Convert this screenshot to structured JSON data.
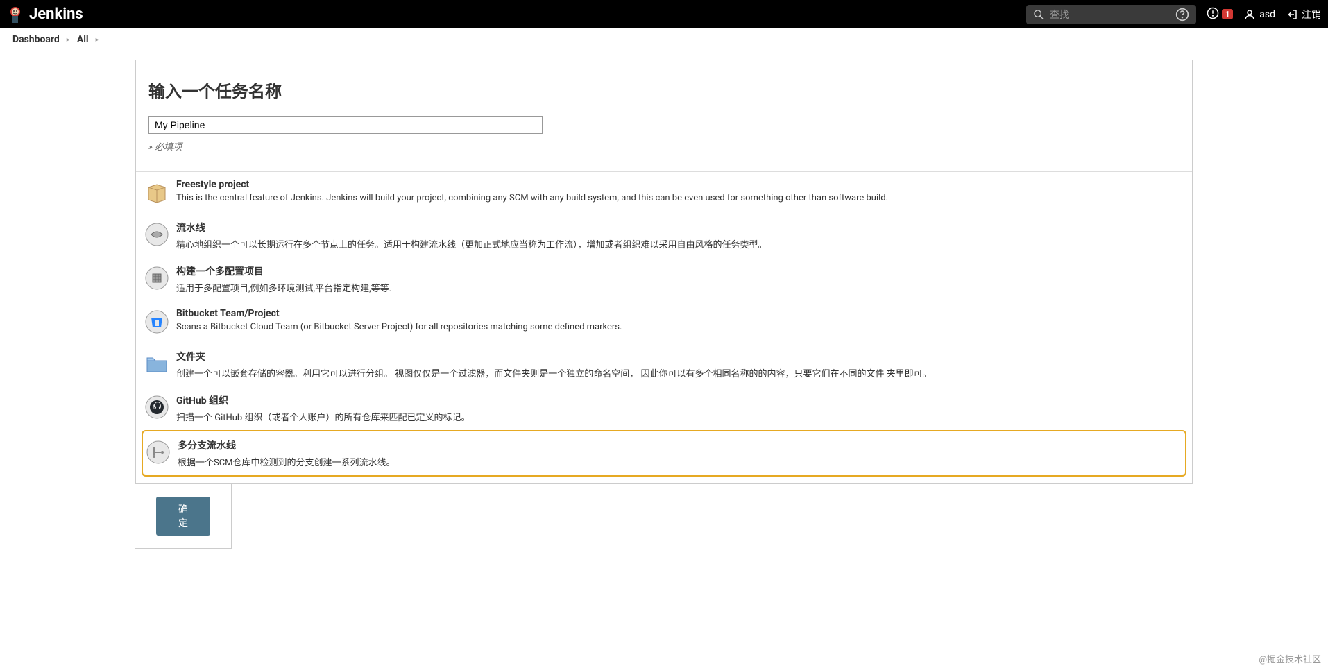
{
  "header": {
    "brand": "Jenkins",
    "search_placeholder": "查找",
    "alert_count": "1",
    "user": "asd",
    "logout": "注销"
  },
  "breadcrumbs": [
    {
      "label": "Dashboard"
    },
    {
      "label": "All"
    }
  ],
  "form": {
    "title": "输入一个任务名称",
    "name_value": "My Pipeline",
    "required_note": "» 必填项",
    "submit": "确定"
  },
  "items": [
    {
      "title": "Freestyle project",
      "desc": "This is the central feature of Jenkins. Jenkins will build your project, combining any SCM with any build system, and this can be even used for something other than software build."
    },
    {
      "title": "流水线",
      "desc": "精心地组织一个可以长期运行在多个节点上的任务。适用于构建流水线（更加正式地应当称为工作流），增加或者组织难以采用自由风格的任务类型。"
    },
    {
      "title": "构建一个多配置项目",
      "desc": "适用于多配置项目,例如多环境测试,平台指定构建,等等."
    },
    {
      "title": "Bitbucket Team/Project",
      "desc": "Scans a Bitbucket Cloud Team (or Bitbucket Server Project) for all repositories matching some defined markers."
    },
    {
      "title": "文件夹",
      "desc": "创建一个可以嵌套存储的容器。利用它可以进行分组。 视图仅仅是一个过滤器，而文件夹则是一个独立的命名空间， 因此你可以有多个相同名称的的内容，只要它们在不同的文件 夹里即可。"
    },
    {
      "title": "GitHub 组织",
      "desc": "扫描一个 GitHub 组织（或者个人账户）的所有仓库来匹配已定义的标记。"
    },
    {
      "title": "多分支流水线",
      "desc": "根据一个SCM仓库中检测到的分支创建一系列流水线。"
    }
  ],
  "watermark": "@掘金技术社区"
}
